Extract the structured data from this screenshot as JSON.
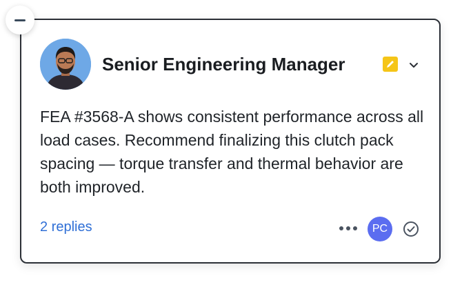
{
  "comment": {
    "author": "Senior Engineering Manager",
    "body": "FEA #3568-A shows consistent performance across all load cases. Recommend finalizing this clutch pack spacing — torque transfer and thermal behavior are both improved.",
    "replies_label": "2 replies",
    "participant_initials": "PC"
  },
  "icons": {
    "collapse": "minus-icon",
    "note": "pencil-note-icon",
    "menu": "chevron-down-icon",
    "more": "more-horizontal-icon",
    "resolve": "check-circle-icon"
  },
  "colors": {
    "link": "#2f6fd6",
    "badge": "#5b6df0",
    "note": "#f5c518",
    "border": "#2b2f36"
  }
}
